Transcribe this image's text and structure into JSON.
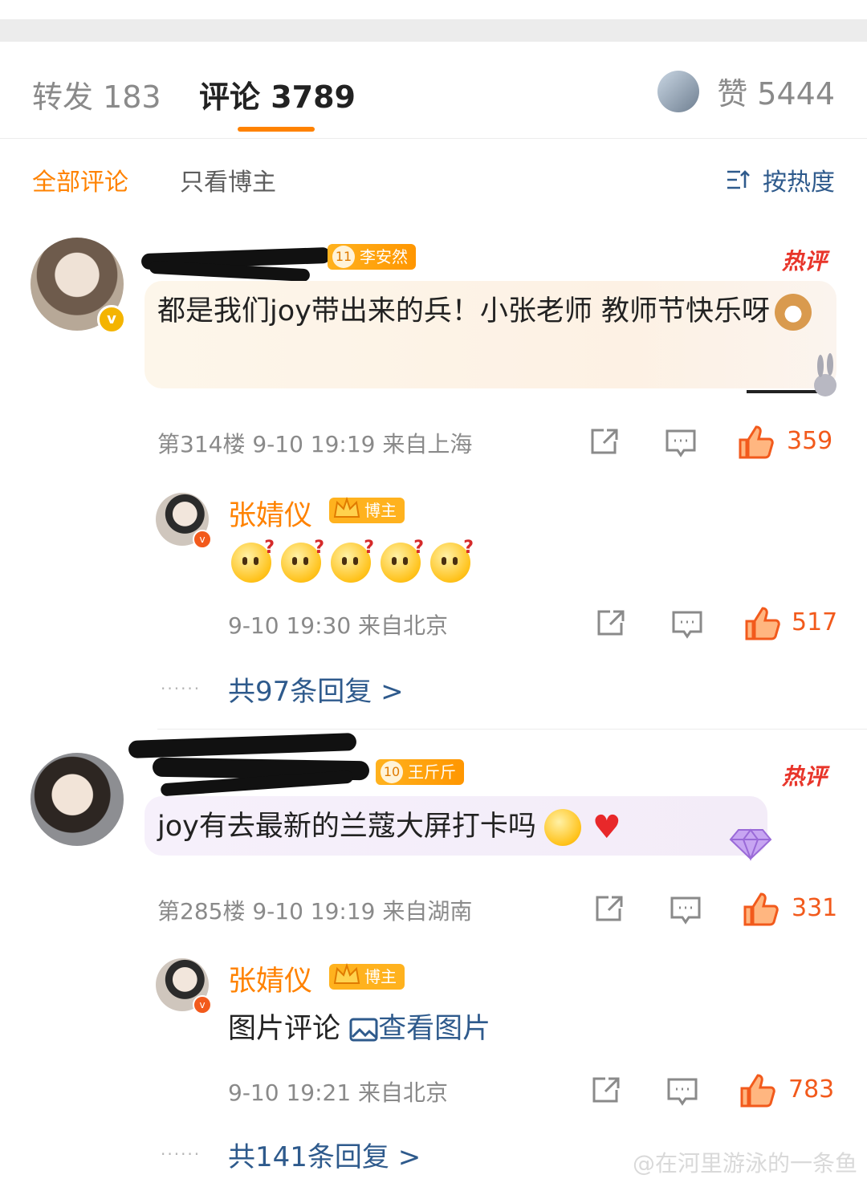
{
  "tabs": {
    "repost_label": "转发 183",
    "comments_label": "评论 3789",
    "likes_label": "赞 5444"
  },
  "filter": {
    "all": "全部评论",
    "owner_only": "只看博主",
    "sort": "按热度"
  },
  "comments": [
    {
      "fan_badge_level": "11",
      "fan_badge_name": "李安然",
      "hot_label": "热评",
      "text": "都是我们joy带出来的兵！小张老师 教师节快乐呀",
      "floor": "第314楼",
      "time": "9-10 19:19",
      "location": "来自上海",
      "likes": "359",
      "reply": {
        "name": "张婧仪",
        "badge": "博主",
        "time": "9-10 19:30",
        "location": "来自北京",
        "likes": "517"
      },
      "more_replies": "共97条回复 >"
    },
    {
      "fan_badge_level": "10",
      "fan_badge_name": "王斤斤",
      "hot_label": "热评",
      "text": "joy有去最新的兰蔻大屏打卡吗",
      "floor": "第285楼",
      "time": "9-10 19:19",
      "location": "来自湖南",
      "likes": "331",
      "reply": {
        "name": "张婧仪",
        "badge": "博主",
        "text": "图片评论",
        "link": "查看图片",
        "time": "9-10 19:21",
        "location": "来自北京",
        "likes": "783"
      },
      "more_replies": "共141条回复 >"
    }
  ],
  "dots": "......",
  "verified_mark": "v",
  "watermark": "@在河里游泳的一条鱼",
  "colors": {
    "accent": "#ff8200",
    "link": "#2e5a8c",
    "like": "#f25a1c",
    "hot": "#e8352a"
  },
  "icons": [
    "share-icon",
    "comment-icon",
    "thumbs-up-icon",
    "sort-icon",
    "image-icon",
    "crown-icon"
  ]
}
